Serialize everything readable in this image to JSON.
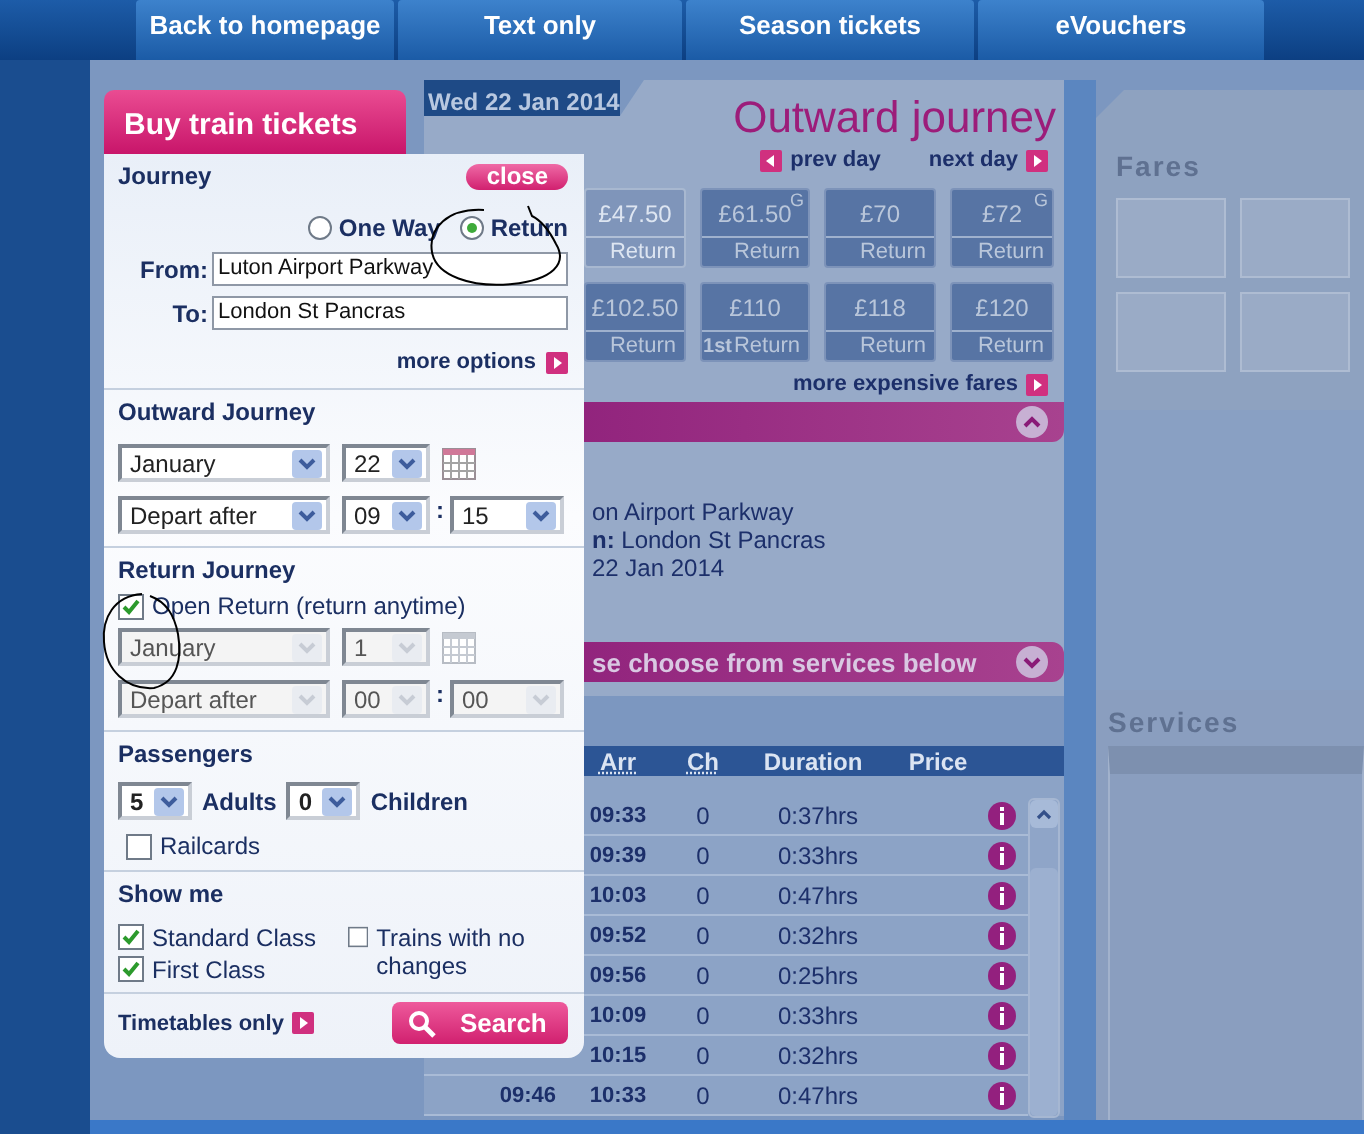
{
  "nav": [
    "Back to homepage",
    "Text only",
    "Season tickets",
    "eVouchers"
  ],
  "booking_panel": {
    "title": "Buy train tickets",
    "close": "close",
    "journey": {
      "heading": "Journey",
      "trip_types": [
        {
          "label": "One Way",
          "selected": false
        },
        {
          "label": "Return",
          "selected": true
        }
      ],
      "from": {
        "label": "From:",
        "value": "Luton Airport Parkway"
      },
      "to": {
        "label": "To:",
        "value": "London St Pancras"
      },
      "more_options": "more options"
    },
    "outward": {
      "heading": "Outward Journey",
      "month": "January",
      "day": "22",
      "mode": "Depart after",
      "hour": "09",
      "separator": ":",
      "minute": "15",
      "disabled": false
    },
    "return": {
      "heading": "Return Journey",
      "open_return": {
        "label": "Open Return (return anytime)",
        "checked": true
      },
      "month": "January",
      "day": "1",
      "mode": "Depart after",
      "hour": "00",
      "separator": ":",
      "minute": "00",
      "disabled": true
    },
    "passengers": {
      "heading": "Passengers",
      "adults": {
        "value": "5",
        "label": "Adults"
      },
      "children": {
        "value": "0",
        "label": "Children"
      },
      "railcards": {
        "label": "Railcards",
        "checked": false
      }
    },
    "show_me": {
      "heading": "Show me",
      "options": [
        {
          "label": "Standard Class",
          "checked": true
        },
        {
          "label": "First Class",
          "checked": true
        },
        {
          "label": "Trains with no changes",
          "checked": false
        }
      ]
    },
    "timetables_link": "Timetables only",
    "search_button": "Search"
  },
  "journey_panel": {
    "date": "Wed 22 Jan 2014",
    "title": "Outward journey",
    "prev_day": "prev day",
    "next_day": "next day",
    "fares": [
      {
        "price": "£47.50",
        "type": "Return",
        "disabled": true
      },
      {
        "price": "£61.50",
        "type": "Return",
        "flag": "G",
        "disabled": false
      },
      {
        "price": "£70",
        "type": "Return",
        "disabled": false
      },
      {
        "price": "£72",
        "type": "Return",
        "flag": "G",
        "disabled": false
      },
      {
        "price": "£102.50",
        "type": "Return",
        "disabled": false
      },
      {
        "price": "£110",
        "type": "Return",
        "prefix": "1st",
        "disabled": false
      },
      {
        "price": "£118",
        "type": "Return",
        "disabled": false
      },
      {
        "price": "£120",
        "type": "Return",
        "disabled": false
      }
    ],
    "more_fares": "more expensive fares",
    "summary_lines": [
      "on Airport Parkway",
      "**n:** London St Pancras",
      "22 Jan 2014"
    ],
    "services_bar": "se choose from services below"
  },
  "services_table": {
    "columns": [
      "Arr",
      "Ch",
      "Duration",
      "Price"
    ],
    "rows": [
      {
        "arr": "09:33",
        "ch": "0",
        "duration": "0:37hrs"
      },
      {
        "arr": "09:39",
        "ch": "0",
        "duration": "0:33hrs"
      },
      {
        "arr": "10:03",
        "ch": "0",
        "duration": "0:47hrs"
      },
      {
        "arr": "09:52",
        "ch": "0",
        "duration": "0:32hrs"
      },
      {
        "arr": "09:56",
        "ch": "0",
        "duration": "0:25hrs"
      },
      {
        "arr": "10:09",
        "ch": "0",
        "duration": "0:33hrs"
      },
      {
        "arr": "10:15",
        "ch": "0",
        "duration": "0:32hrs"
      },
      {
        "dep": "09:46",
        "arr": "10:33",
        "ch": "0",
        "duration": "0:47hrs"
      }
    ]
  },
  "side": {
    "fares_heading": "Fares",
    "services_heading": "Services"
  }
}
